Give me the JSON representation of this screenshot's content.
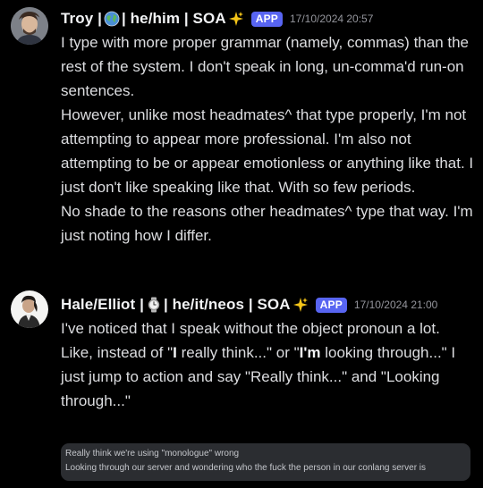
{
  "messages": [
    {
      "author": "Troy | 🌏 | he/him | SOA ✨",
      "author_parts": {
        "name": "Troy |",
        "pronouns": "| he/him | SOA"
      },
      "badge": "APP",
      "timestamp": "17/10/2024 20:57",
      "avatar_icon": "person-avatar-icon",
      "paragraphs": [
        "I type with more proper grammar (namely, commas) than the rest of the system. I don't speak in long, un-comma'd run-on sentences.",
        "However, unlike most headmates^ that type properly, I'm not attempting to appear more professional. I'm also not attempting to be or appear emotionless or anything like that. I just don't like speaking like that. With so few periods.",
        "No shade to the reasons other headmates^ type that way. I'm just noting how I differ."
      ]
    },
    {
      "author": "Hale/Elliot | ⌚ | he/it/neos | SOA ✨",
      "author_parts": {
        "name": "Hale/Elliot |",
        "pronouns": "| he/it/neos | SOA"
      },
      "badge": "APP",
      "timestamp": "17/10/2024 21:00",
      "avatar_icon": "person-avatar-icon",
      "paragraphs": [
        "I've noticed that I speak without the object pronoun a lot."
      ],
      "para2": {
        "t1": "Like, instead of \"",
        "b1": "I",
        "t2": " really think...\" or \"",
        "b2": "I'm",
        "t3": " looking through...\" I just jump to action and say \"Really think...\" and \"Looking through...\""
      },
      "quote_lines": [
        "Really think we're using \"monologue\" wrong",
        "Looking through our server and wondering who the fuck the person in our conlang server is"
      ]
    }
  ],
  "colors": {
    "background": "#000000",
    "text": "#dcdde0",
    "author": "#f2f3f5",
    "badge": "#5865f2",
    "timestamp": "#94959c",
    "quote_background": "#2b2d31"
  },
  "icons": {
    "globe": "globe-icon",
    "sparkles": "sparkles-icon",
    "watch": "watch-icon"
  }
}
